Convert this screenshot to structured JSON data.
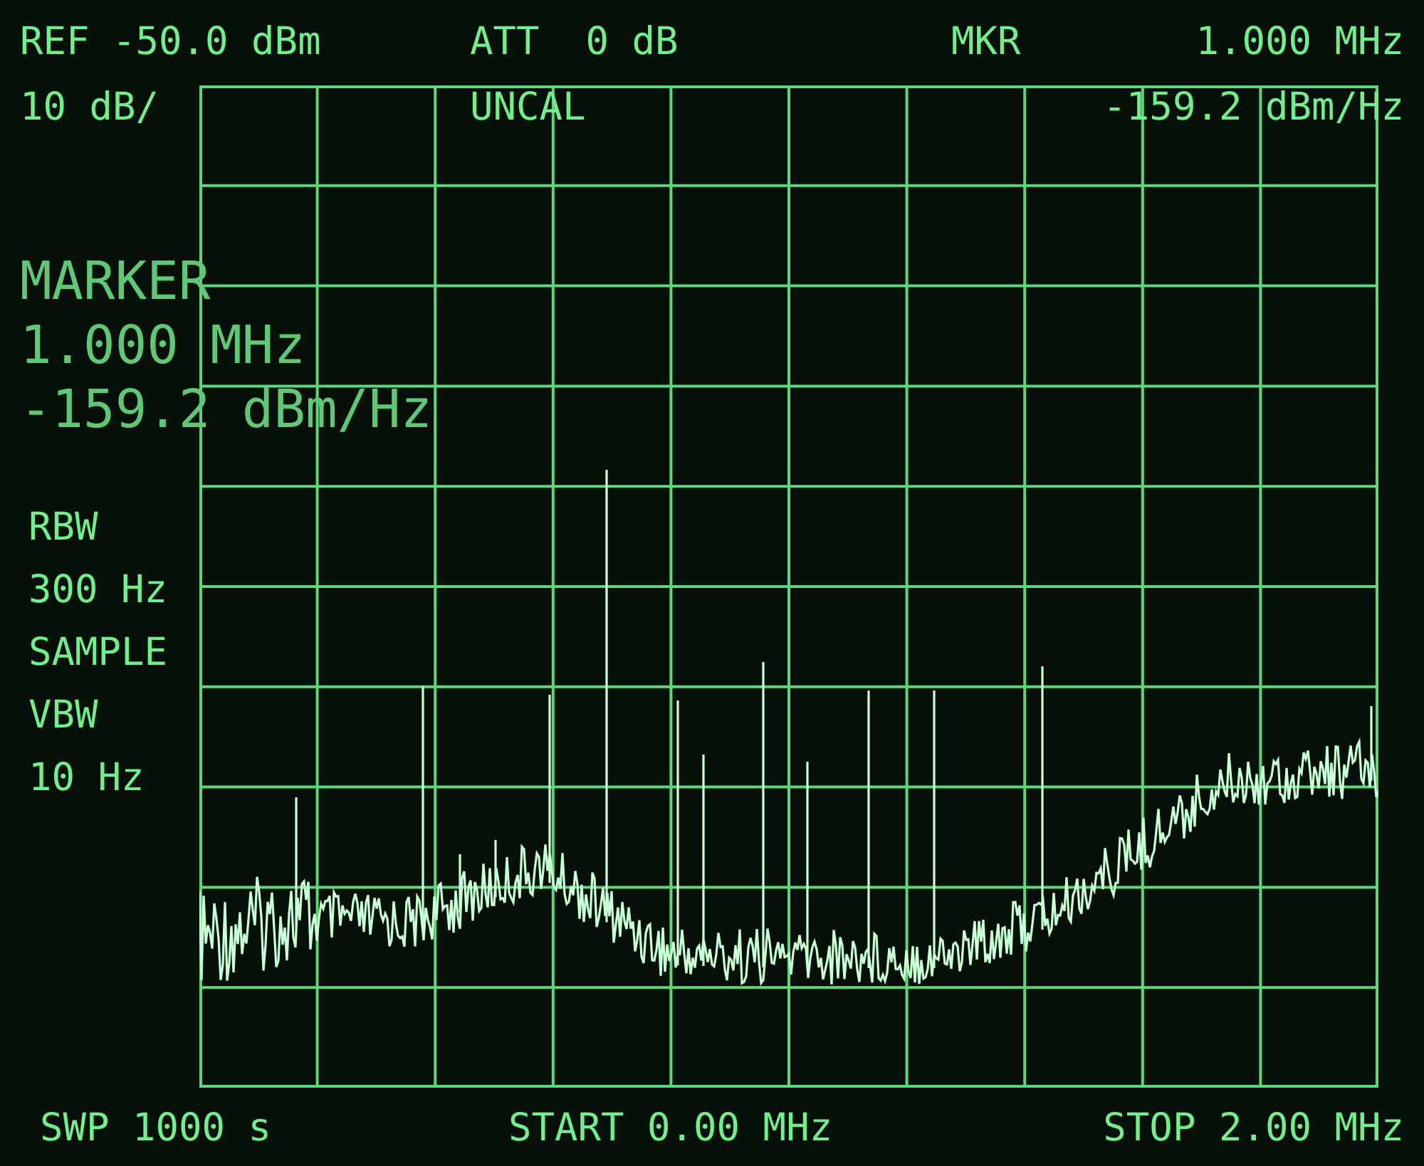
{
  "header": {
    "reference": "REF -50.0 dBm",
    "attenuation": "ATT  0 dB",
    "marker_label": "MKR",
    "marker_frequency": "1.000 MHz",
    "scale": "10 dB/",
    "uncal": "UNCAL",
    "marker_level": "-159.2 dBm/Hz"
  },
  "marker_readout": [
    "MARKER",
    "1.000 MHz",
    "-159.2 dBm/Hz"
  ],
  "settings": [
    "RBW",
    "300 Hz",
    "SAMPLE",
    "VBW",
    "10 Hz"
  ],
  "footer": {
    "sweep": "SWP 1000 s",
    "start": "START 0.00 MHz",
    "stop": "STOP 2.00 MHz"
  }
}
